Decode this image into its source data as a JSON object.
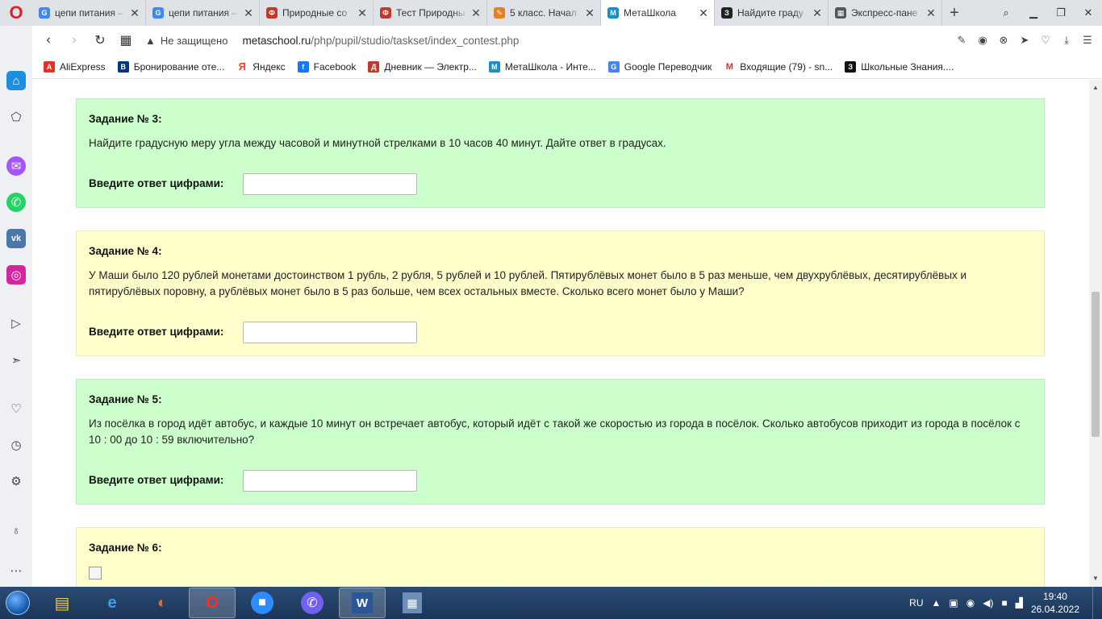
{
  "tabs": [
    {
      "title": "цепи питания –",
      "fav": "G",
      "color": "#4285f4",
      "active": false
    },
    {
      "title": "цепи питания –",
      "fav": "G",
      "color": "#4285f4",
      "active": false
    },
    {
      "title": "Природные со",
      "fav": "Ф",
      "color": "#c0392b",
      "active": false
    },
    {
      "title": "Тест Природны",
      "fav": "Ф",
      "color": "#c0392b",
      "active": false
    },
    {
      "title": "5 класс. Начал",
      "fav": "✎",
      "color": "#e67e22",
      "active": false
    },
    {
      "title": "МетаШкола",
      "fav": "М",
      "color": "#1a8fc7",
      "active": true
    },
    {
      "title": "Найдите граду",
      "fav": "З",
      "color": "#222222",
      "active": false
    },
    {
      "title": "Экспресс-пане",
      "fav": "▦",
      "color": "#555555",
      "active": false
    }
  ],
  "address": {
    "security": "Не защищено",
    "host": "metaschool.ru",
    "path": "/php/pupil/studio/taskset/index_contest.php"
  },
  "bookmarks": [
    {
      "label": "AliExpress",
      "fav": "A",
      "color": "#e43225"
    },
    {
      "label": "Бронирование оте...",
      "fav": "B",
      "color": "#003580"
    },
    {
      "label": "Яндекс",
      "fav": "Я",
      "color": "#fc3f1d"
    },
    {
      "label": "Facebook",
      "fav": "f",
      "color": "#1877f2"
    },
    {
      "label": "Дневник — Электр...",
      "fav": "Д",
      "color": "#c0392b"
    },
    {
      "label": "МетаШкола - Инте...",
      "fav": "М",
      "color": "#1a8fc7"
    },
    {
      "label": "Google Переводчик",
      "fav": "G",
      "color": "#4285f4"
    },
    {
      "label": "Входящие (79) - sn...",
      "fav": "M",
      "color": "#d93025"
    },
    {
      "label": "Школьные Знания....",
      "fav": "З",
      "color": "#111111"
    }
  ],
  "tasks": [
    {
      "title": "Задание № 3:",
      "text": "Найдите градусную меру угла между часовой и минутной стрелками в 10 часов 40 минут. Дайте ответ в градусах.",
      "answer_label": "Введите ответ цифрами:",
      "answer_value": ""
    },
    {
      "title": "Задание № 4:",
      "text": "У Маши было 120 рублей монетами достоинством 1 рубль, 2 рубля, 5 рублей и 10 рублей. Пятирублёвых монет было в 5 раз меньше, чем двухрублёвых, десятирублёвых и пятирублёвых поровну, а рублёвых монет было в 5 раз больше, чем всех остальных вместе. Сколько всего монет было у Маши?",
      "answer_label": "Введите ответ цифрами:",
      "answer_value": ""
    },
    {
      "title": "Задание № 5:",
      "text": "Из посёлка в город идёт автобус, и каждые 10 минут он встречает автобус, который идёт с такой же скоростью из города в посёлок. Сколько автобусов приходит из города в посёлок с 10 : 00 до 10 : 59 включительно?",
      "answer_label": "Введите ответ цифрами:",
      "answer_value": ""
    },
    {
      "title": "Задание № 6:"
    }
  ],
  "taskbar": {
    "language": "RU",
    "time": "19:40",
    "date": "26.04.2022"
  }
}
